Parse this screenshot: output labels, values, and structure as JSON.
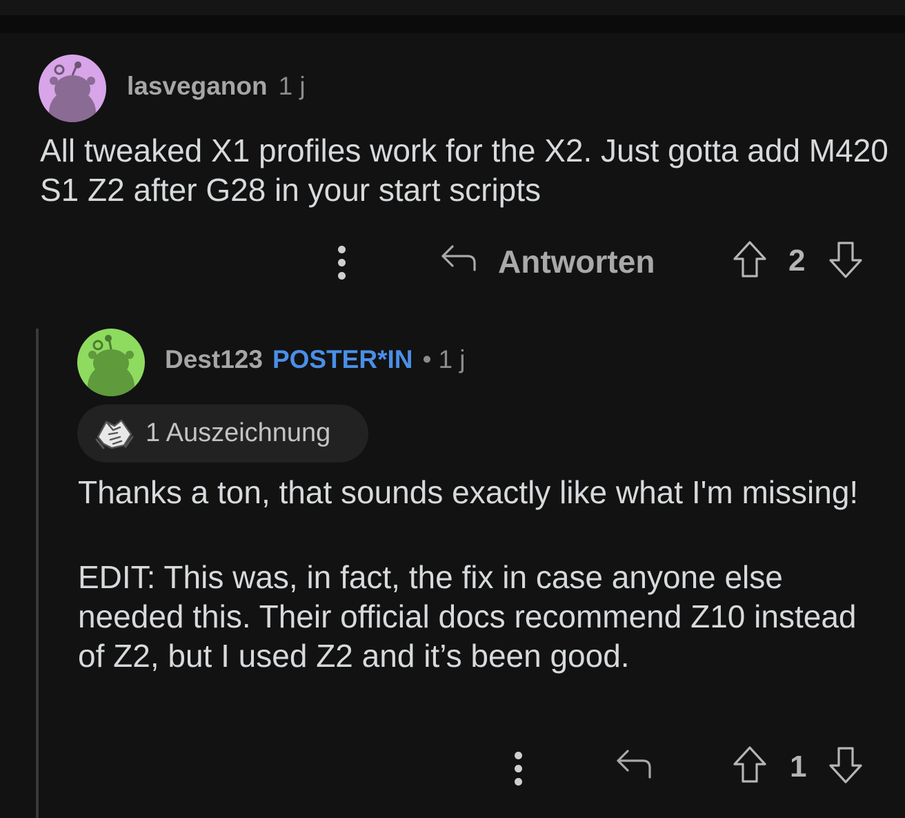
{
  "comments": [
    {
      "username": "lasveganon",
      "time": "1 j",
      "avatar_icon": "snoo-avatar-icon",
      "avatar_color": "#d7a5e8",
      "body": "All tweaked X1 profiles work for the X2.  Just gotta add M420 S1 Z2 after G28 in your start scripts",
      "actions": {
        "more_icon": "kebab-vertical-icon",
        "reply_icon": "reply-arrow-icon",
        "reply_label": "Antworten",
        "upvote_icon": "upvote-arrow-icon",
        "score": "2",
        "downvote_icon": "downvote-arrow-icon"
      }
    },
    {
      "username": "Dest123",
      "flair": "POSTER*IN",
      "separator": "•",
      "time": "1 j",
      "avatar_icon": "snoo-avatar-icon",
      "avatar_color": "#8edb60",
      "award": {
        "icon": "handshake-award-icon",
        "label": "1 Auszeichnung"
      },
      "body_paragraphs": [
        "Thanks a ton, that sounds exactly like what I'm missing!",
        "EDIT: This was, in fact, the fix in case anyone else needed this.  Their official docs recommend Z10 instead of Z2, but I used Z2 and it’s been good."
      ],
      "actions": {
        "more_icon": "kebab-vertical-icon",
        "reply_icon": "reply-arrow-icon",
        "upvote_icon": "upvote-arrow-icon",
        "score": "1",
        "downvote_icon": "downvote-arrow-icon"
      }
    }
  ],
  "colors": {
    "background": "#121212",
    "flair": "#4a8fe8",
    "text": "#d7dadc"
  }
}
